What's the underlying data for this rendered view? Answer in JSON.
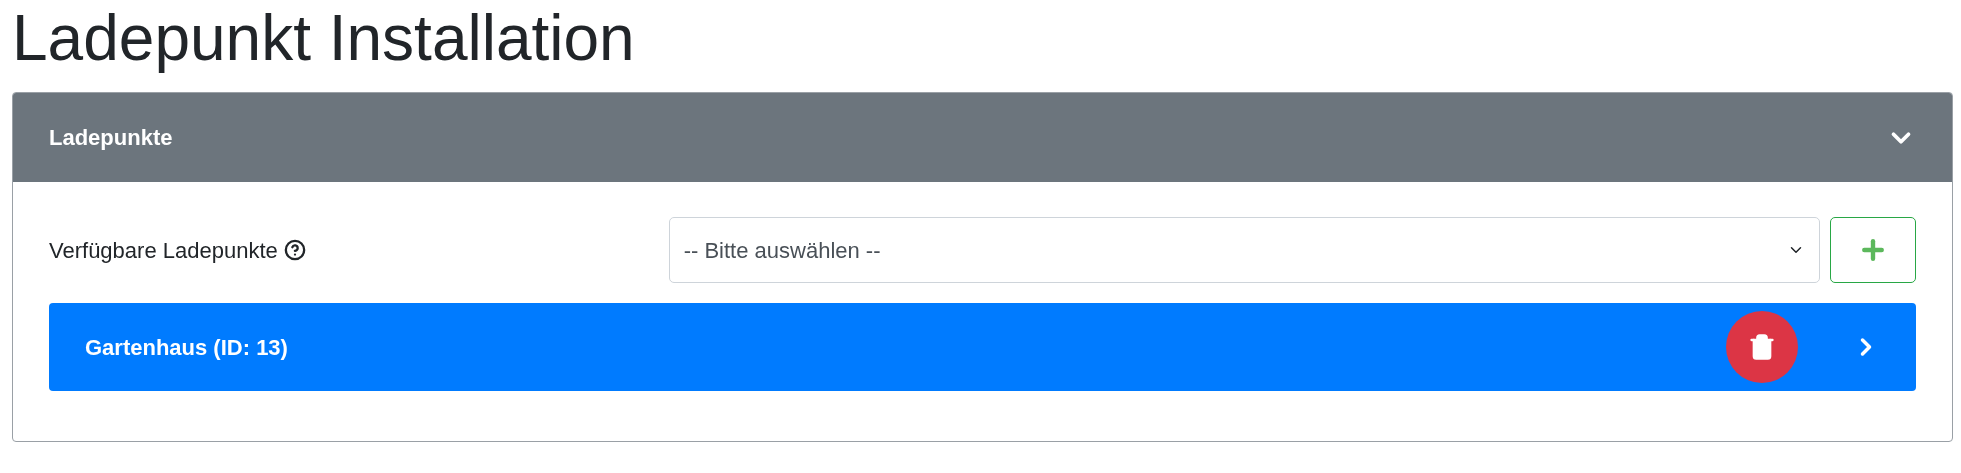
{
  "page_title": "Ladepunkt Installation",
  "panel": {
    "title": "Ladepunkte",
    "expanded": true,
    "field": {
      "label": "Verfügbare Ladepunkte",
      "select_value": "-- Bitte auswählen --"
    },
    "items": [
      {
        "title": "Gartenhaus (ID: 13)",
        "expanded": false
      }
    ]
  }
}
